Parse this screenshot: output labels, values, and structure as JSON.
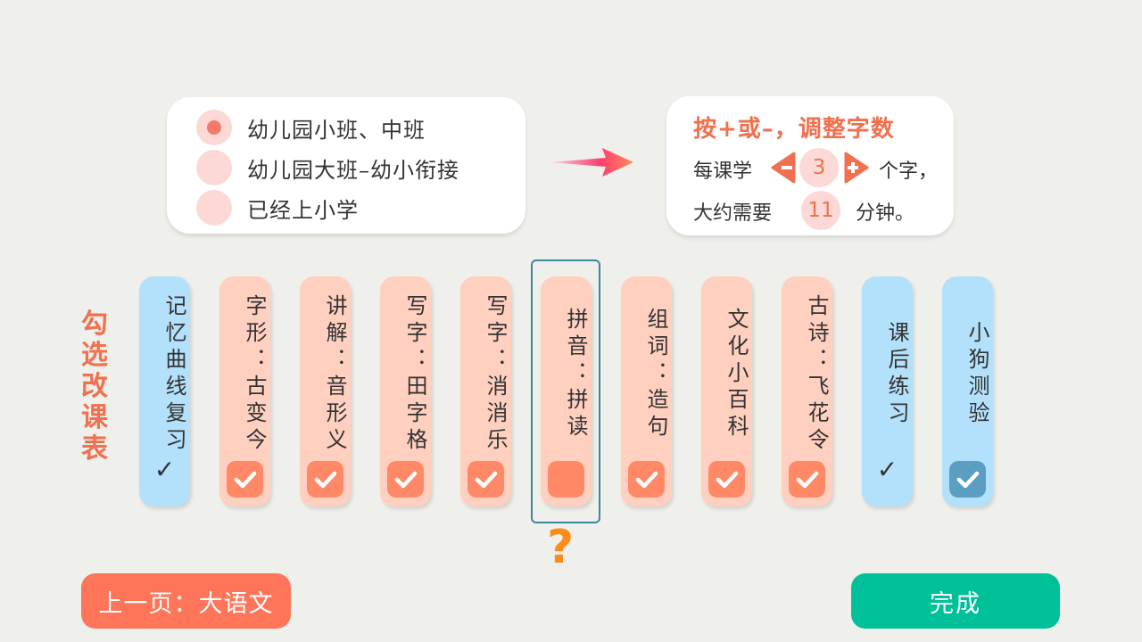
{
  "levels": {
    "options": [
      {
        "label": "幼儿园小班、中班",
        "selected": true
      },
      {
        "label": "幼儿园大班–幼小衔接",
        "selected": false
      },
      {
        "label": "已经上小学",
        "selected": false
      }
    ]
  },
  "count": {
    "title": "按+或–，调整字数",
    "prefix": "每课学",
    "value": "3",
    "suffix": "个字，",
    "time_prefix": "大约需要",
    "minutes": "11",
    "time_suffix": "分钟。"
  },
  "side_label": "勾选改课表",
  "modules": [
    {
      "label": "记忆曲线复习",
      "theme": "blue",
      "state": "tick"
    },
    {
      "label": "字形：古变今",
      "theme": "peach",
      "state": "checked"
    },
    {
      "label": "讲解：音形义",
      "theme": "peach",
      "state": "checked"
    },
    {
      "label": "写字：田字格",
      "theme": "peach",
      "state": "checked"
    },
    {
      "label": "写字：消消乐",
      "theme": "peach",
      "state": "checked"
    },
    {
      "label": "拼音：拼读",
      "theme": "peach",
      "state": "unchecked"
    },
    {
      "label": "组词：造句",
      "theme": "peach",
      "state": "checked"
    },
    {
      "label": "文化小百科",
      "theme": "peach",
      "state": "checked"
    },
    {
      "label": "古诗：飞花令",
      "theme": "peach",
      "state": "checked"
    },
    {
      "label": "课后练习",
      "theme": "blue",
      "state": "tick"
    },
    {
      "label": "小狗测验",
      "theme": "blue",
      "state": "checked-teal"
    }
  ],
  "tick_mark": "✓",
  "question_mark": "?",
  "buttons": {
    "prev": "上一页：大语文",
    "done": "完成"
  },
  "colors": {
    "accent": "#f0704f",
    "module_peach": "#ffd0bf",
    "module_blue": "#b3e1fb",
    "checkbox_orange": "#ff8866",
    "checkbox_teal": "#5a9fc2",
    "done_green": "#00c09a",
    "prev_orange": "#ff7559"
  }
}
